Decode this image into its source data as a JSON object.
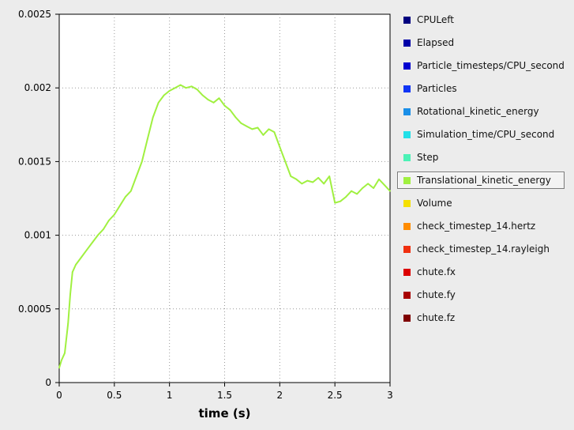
{
  "chart_data": {
    "type": "line",
    "xlabel": "time (s)",
    "ylabel": "",
    "xlim": [
      0,
      3
    ],
    "ylim": [
      0,
      0.0025
    ],
    "x_ticks": [
      "0",
      "0.5",
      "1",
      "1.5",
      "2",
      "2.5",
      "3"
    ],
    "y_ticks": [
      "0",
      "0.0005",
      "0.001",
      "0.0015",
      "0.002",
      "0.0025"
    ],
    "grid": true,
    "legend_placement": "right",
    "legend": [
      {
        "name": "CPULeft",
        "color": "#00007f"
      },
      {
        "name": "Elapsed",
        "color": "#0000a8"
      },
      {
        "name": "Particle_timesteps/CPU_second",
        "color": "#0000d0"
      },
      {
        "name": "Particles",
        "color": "#1035f5"
      },
      {
        "name": "Rotational_kinetic_energy",
        "color": "#1a8fe8"
      },
      {
        "name": "Simulation_time/CPU_second",
        "color": "#22e0e8"
      },
      {
        "name": "Step",
        "color": "#4cf2b6"
      },
      {
        "name": "Translational_kinetic_energy",
        "color": "#a0f040",
        "selected": true
      },
      {
        "name": "Volume",
        "color": "#f5e000"
      },
      {
        "name": "check_timestep_14.hertz",
        "color": "#ff8c00"
      },
      {
        "name": "check_timestep_14.rayleigh",
        "color": "#f03010"
      },
      {
        "name": "chute.fx",
        "color": "#dc0000"
      },
      {
        "name": "chute.fy",
        "color": "#a80000"
      },
      {
        "name": "chute.fz",
        "color": "#7f0000"
      }
    ],
    "series": [
      {
        "name": "Translational_kinetic_energy",
        "color": "#a0f040",
        "x": [
          0,
          0.02,
          0.05,
          0.08,
          0.1,
          0.12,
          0.15,
          0.2,
          0.25,
          0.3,
          0.35,
          0.4,
          0.45,
          0.5,
          0.55,
          0.6,
          0.65,
          0.7,
          0.75,
          0.8,
          0.85,
          0.9,
          0.95,
          1.0,
          1.05,
          1.1,
          1.15,
          1.2,
          1.25,
          1.3,
          1.35,
          1.4,
          1.45,
          1.5,
          1.55,
          1.6,
          1.65,
          1.7,
          1.75,
          1.8,
          1.85,
          1.9,
          1.95,
          2.0,
          2.05,
          2.1,
          2.15,
          2.2,
          2.25,
          2.3,
          2.35,
          2.4,
          2.45,
          2.5,
          2.55,
          2.6,
          2.65,
          2.7,
          2.75,
          2.8,
          2.85,
          2.9,
          2.95,
          3.0
        ],
        "values": [
          0.0001,
          0.00015,
          0.0002,
          0.0004,
          0.0006,
          0.00075,
          0.0008,
          0.00085,
          0.0009,
          0.00095,
          0.001,
          0.00104,
          0.0011,
          0.00114,
          0.0012,
          0.00126,
          0.0013,
          0.0014,
          0.0015,
          0.00165,
          0.0018,
          0.0019,
          0.00195,
          0.00198,
          0.002,
          0.00202,
          0.002,
          0.00201,
          0.00199,
          0.00195,
          0.00192,
          0.0019,
          0.00193,
          0.00188,
          0.00185,
          0.0018,
          0.00176,
          0.00174,
          0.00172,
          0.00173,
          0.00168,
          0.00172,
          0.0017,
          0.0016,
          0.0015,
          0.0014,
          0.00138,
          0.00135,
          0.00137,
          0.00136,
          0.00139,
          0.00135,
          0.0014,
          0.00122,
          0.00123,
          0.00126,
          0.0013,
          0.00128,
          0.00132,
          0.00135,
          0.00132,
          0.00138,
          0.00134,
          0.0013
        ]
      }
    ]
  }
}
